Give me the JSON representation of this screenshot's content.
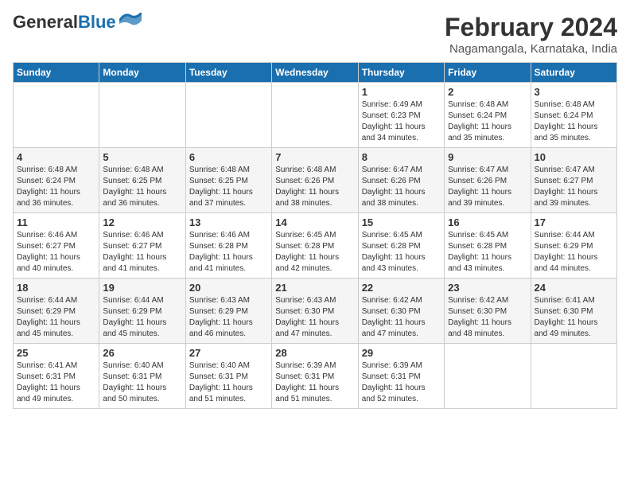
{
  "logo": {
    "line1": "General",
    "line2": "Blue"
  },
  "title": "February 2024",
  "subtitle": "Nagamangala, Karnataka, India",
  "days_of_week": [
    "Sunday",
    "Monday",
    "Tuesday",
    "Wednesday",
    "Thursday",
    "Friday",
    "Saturday"
  ],
  "weeks": [
    [
      {
        "day": "",
        "info": ""
      },
      {
        "day": "",
        "info": ""
      },
      {
        "day": "",
        "info": ""
      },
      {
        "day": "",
        "info": ""
      },
      {
        "day": "1",
        "info": "Sunrise: 6:49 AM\nSunset: 6:23 PM\nDaylight: 11 hours\nand 34 minutes."
      },
      {
        "day": "2",
        "info": "Sunrise: 6:48 AM\nSunset: 6:24 PM\nDaylight: 11 hours\nand 35 minutes."
      },
      {
        "day": "3",
        "info": "Sunrise: 6:48 AM\nSunset: 6:24 PM\nDaylight: 11 hours\nand 35 minutes."
      }
    ],
    [
      {
        "day": "4",
        "info": "Sunrise: 6:48 AM\nSunset: 6:24 PM\nDaylight: 11 hours\nand 36 minutes."
      },
      {
        "day": "5",
        "info": "Sunrise: 6:48 AM\nSunset: 6:25 PM\nDaylight: 11 hours\nand 36 minutes."
      },
      {
        "day": "6",
        "info": "Sunrise: 6:48 AM\nSunset: 6:25 PM\nDaylight: 11 hours\nand 37 minutes."
      },
      {
        "day": "7",
        "info": "Sunrise: 6:48 AM\nSunset: 6:26 PM\nDaylight: 11 hours\nand 38 minutes."
      },
      {
        "day": "8",
        "info": "Sunrise: 6:47 AM\nSunset: 6:26 PM\nDaylight: 11 hours\nand 38 minutes."
      },
      {
        "day": "9",
        "info": "Sunrise: 6:47 AM\nSunset: 6:26 PM\nDaylight: 11 hours\nand 39 minutes."
      },
      {
        "day": "10",
        "info": "Sunrise: 6:47 AM\nSunset: 6:27 PM\nDaylight: 11 hours\nand 39 minutes."
      }
    ],
    [
      {
        "day": "11",
        "info": "Sunrise: 6:46 AM\nSunset: 6:27 PM\nDaylight: 11 hours\nand 40 minutes."
      },
      {
        "day": "12",
        "info": "Sunrise: 6:46 AM\nSunset: 6:27 PM\nDaylight: 11 hours\nand 41 minutes."
      },
      {
        "day": "13",
        "info": "Sunrise: 6:46 AM\nSunset: 6:28 PM\nDaylight: 11 hours\nand 41 minutes."
      },
      {
        "day": "14",
        "info": "Sunrise: 6:45 AM\nSunset: 6:28 PM\nDaylight: 11 hours\nand 42 minutes."
      },
      {
        "day": "15",
        "info": "Sunrise: 6:45 AM\nSunset: 6:28 PM\nDaylight: 11 hours\nand 43 minutes."
      },
      {
        "day": "16",
        "info": "Sunrise: 6:45 AM\nSunset: 6:28 PM\nDaylight: 11 hours\nand 43 minutes."
      },
      {
        "day": "17",
        "info": "Sunrise: 6:44 AM\nSunset: 6:29 PM\nDaylight: 11 hours\nand 44 minutes."
      }
    ],
    [
      {
        "day": "18",
        "info": "Sunrise: 6:44 AM\nSunset: 6:29 PM\nDaylight: 11 hours\nand 45 minutes."
      },
      {
        "day": "19",
        "info": "Sunrise: 6:44 AM\nSunset: 6:29 PM\nDaylight: 11 hours\nand 45 minutes."
      },
      {
        "day": "20",
        "info": "Sunrise: 6:43 AM\nSunset: 6:29 PM\nDaylight: 11 hours\nand 46 minutes."
      },
      {
        "day": "21",
        "info": "Sunrise: 6:43 AM\nSunset: 6:30 PM\nDaylight: 11 hours\nand 47 minutes."
      },
      {
        "day": "22",
        "info": "Sunrise: 6:42 AM\nSunset: 6:30 PM\nDaylight: 11 hours\nand 47 minutes."
      },
      {
        "day": "23",
        "info": "Sunrise: 6:42 AM\nSunset: 6:30 PM\nDaylight: 11 hours\nand 48 minutes."
      },
      {
        "day": "24",
        "info": "Sunrise: 6:41 AM\nSunset: 6:30 PM\nDaylight: 11 hours\nand 49 minutes."
      }
    ],
    [
      {
        "day": "25",
        "info": "Sunrise: 6:41 AM\nSunset: 6:31 PM\nDaylight: 11 hours\nand 49 minutes."
      },
      {
        "day": "26",
        "info": "Sunrise: 6:40 AM\nSunset: 6:31 PM\nDaylight: 11 hours\nand 50 minutes."
      },
      {
        "day": "27",
        "info": "Sunrise: 6:40 AM\nSunset: 6:31 PM\nDaylight: 11 hours\nand 51 minutes."
      },
      {
        "day": "28",
        "info": "Sunrise: 6:39 AM\nSunset: 6:31 PM\nDaylight: 11 hours\nand 51 minutes."
      },
      {
        "day": "29",
        "info": "Sunrise: 6:39 AM\nSunset: 6:31 PM\nDaylight: 11 hours\nand 52 minutes."
      },
      {
        "day": "",
        "info": ""
      },
      {
        "day": "",
        "info": ""
      }
    ]
  ]
}
